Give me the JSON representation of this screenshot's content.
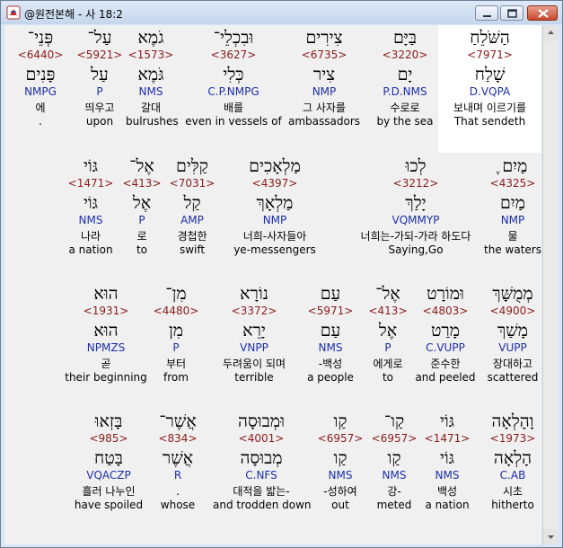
{
  "window": {
    "title": "@원전본해 - 사 18:2"
  },
  "rows": [
    {
      "words": [
        {
          "heb": "פְּנֵי־",
          "strong": "<6440>",
          "lemma": "פָּנִים",
          "morph": "NMPG",
          "kor": "에",
          "eng": "."
        },
        {
          "heb": "עַל־",
          "strong": "<5921>",
          "lemma": "עַל",
          "morph": "P",
          "kor": "띄우고",
          "eng": "upon"
        },
        {
          "heb": "גֹמֶא",
          "strong": "<1573>",
          "lemma": "גֹּמֶא",
          "morph": "NMS",
          "kor": "갈대",
          "eng": "bulrushes"
        },
        {
          "heb": "וּבִכְלֵי־",
          "strong": "<3627>",
          "lemma": "כְּלִי",
          "morph": "C.P.NMPG",
          "kor": "배를",
          "eng": "even in vessels of"
        },
        {
          "heb": "צִירִים",
          "strong": "<6735>",
          "lemma": "צִיר",
          "morph": "NMP",
          "kor": "그 사자를",
          "eng": "ambassadors"
        },
        {
          "heb": "בַּיָּם",
          "strong": "<3220>",
          "lemma": "יָם",
          "morph": "P.D.NMS",
          "kor": "수로로",
          "eng": "by the sea"
        },
        {
          "heb": "הַשֹּׁלֵחַ",
          "strong": "<7971>",
          "lemma": "שָׁלַח",
          "morph": "D.VQPA",
          "kor": "보내며 이르기를",
          "eng": "That sendeth",
          "highlight": true
        }
      ]
    },
    {
      "words": [
        {
          "heb": "גּוֹי",
          "strong": "<1471>",
          "lemma": "גּוֹי",
          "morph": "NMS",
          "kor": "나라",
          "eng": "a nation"
        },
        {
          "heb": "אֶל־",
          "strong": "<413>",
          "lemma": "אֶל",
          "morph": "P",
          "kor": "로",
          "eng": "to"
        },
        {
          "heb": "קַלִּים",
          "strong": "<7031>",
          "lemma": "קַל",
          "morph": "AMP",
          "kor": "경첩한",
          "eng": "swift"
        },
        {
          "heb": "מַלְאָכִים",
          "strong": "<4397>",
          "lemma": "מַלְאָךְ",
          "morph": "NMP",
          "kor": "너희-사자들아",
          "eng": "ye-messengers"
        },
        {
          "heb": "לְכוּ",
          "strong": "<3212>",
          "lemma": "יָלַךְ",
          "morph": "VQMMYP",
          "kor": "너희는-가되-가라 하도다",
          "eng": "Saying,Go"
        },
        {
          "heb": "מַיִם ֶ",
          "strong": "<4325>",
          "lemma": "מַיִם",
          "morph": "NMP",
          "kor": "물",
          "eng": "the waters"
        }
      ]
    },
    {
      "words": [
        {
          "heb": "הוּא",
          "strong": "<1931>",
          "lemma": "הוּא",
          "morph": "NPMZS",
          "kor": "곧",
          "eng": "their beginning"
        },
        {
          "heb": "מִן־",
          "strong": "<4480>",
          "lemma": "מִן",
          "morph": "P",
          "kor": "부터",
          "eng": "from"
        },
        {
          "heb": "נוֹרָא",
          "strong": "<3372>",
          "lemma": "יָרֵא",
          "morph": "VNPP",
          "kor": "두려움이 되며",
          "eng": "terrible"
        },
        {
          "heb": "עַם",
          "strong": "<5971>",
          "lemma": "עַם",
          "morph": "NMS",
          "kor": "-백성",
          "eng": "a people"
        },
        {
          "heb": "אֶל־",
          "strong": "<413>",
          "lemma": "אֶל",
          "morph": "P",
          "kor": "에게로",
          "eng": "to"
        },
        {
          "heb": "וּמוֹרָט",
          "strong": "<4803>",
          "lemma": "מָרַט",
          "morph": "C.VUPP",
          "kor": "준수한",
          "eng": "and peeled"
        },
        {
          "heb": "מְמֻשָּׁךְ",
          "strong": "<4900>",
          "lemma": "מָשַׁךְ",
          "morph": "VUPP",
          "kor": "장대하고",
          "eng": "scattered"
        }
      ]
    },
    {
      "words": [
        {
          "heb": "בָּזְאוּ",
          "strong": "<985>",
          "lemma": "בָּטַח",
          "morph": "VQACZP",
          "kor": "흘러 나누인",
          "eng": "have spoiled"
        },
        {
          "heb": "אֲשֶׁר־",
          "strong": "<834>",
          "lemma": "אֲשֶׁר",
          "morph": "R",
          "kor": ".",
          "eng": "whose"
        },
        {
          "heb": "וּמְבוּסָה",
          "strong": "<4001>",
          "lemma": "מְבוּסָה",
          "morph": "C.NFS",
          "kor": "대적을 밟는-",
          "eng": "and trodden down"
        },
        {
          "heb": "קַו",
          "strong": "<6957>",
          "lemma": "קַו",
          "morph": "NMS",
          "kor": "-성하여",
          "eng": "out"
        },
        {
          "heb": "קַו־",
          "strong": "<6957>",
          "lemma": "קַו",
          "morph": "NMS",
          "kor": "강-",
          "eng": "meted"
        },
        {
          "heb": "גּוֹי",
          "strong": "<1471>",
          "lemma": "גּוֹי",
          "morph": "NMS",
          "kor": "백성",
          "eng": "a nation"
        },
        {
          "heb": "וָהָלְאָה",
          "strong": "<1973>",
          "lemma": "הָלְאָה",
          "morph": "C.AB",
          "kor": "시초",
          "eng": "hitherto"
        }
      ]
    }
  ]
}
